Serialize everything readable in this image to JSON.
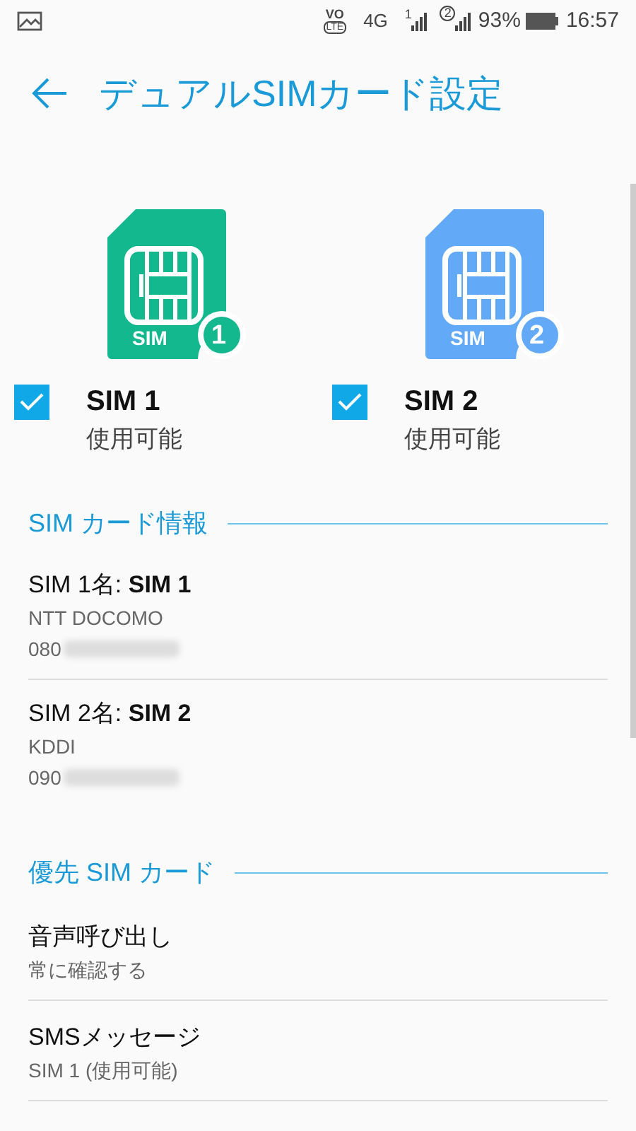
{
  "status_bar": {
    "volte_top": "VO",
    "volte_bottom": "LTE",
    "network": "4G",
    "sim1_index": "1",
    "sim2_index": "2",
    "battery": "93%",
    "time": "16:57"
  },
  "header": {
    "title": "デュアルSIMカード設定"
  },
  "sims": [
    {
      "card_text": "SIM",
      "number": "1",
      "color": "#14b88e",
      "checked": true,
      "name": "SIM 1",
      "status": "使用可能"
    },
    {
      "card_text": "SIM",
      "number": "2",
      "color": "#62a9f7",
      "checked": true,
      "name": "SIM 2",
      "status": "使用可能"
    }
  ],
  "sections": [
    {
      "title": "SIM カード情報",
      "items": [
        {
          "kind": "info",
          "title": "SIM 1名: **SIM 1**",
          "lines": [
            "NTT DOCOMO",
            "080"
          ]
        },
        {
          "kind": "info",
          "title": "SIM 2名: **SIM 2**",
          "lines": [
            "KDDI",
            "090"
          ]
        }
      ]
    },
    {
      "title": "優先 SIM カード",
      "items": [
        {
          "kind": "pref",
          "title": "音声呼び出し",
          "lines": [
            "常に確認する"
          ]
        },
        {
          "kind": "pref",
          "title": "SMSメッセージ",
          "lines": [
            "SIM 1 (使用可能)"
          ]
        }
      ]
    }
  ]
}
